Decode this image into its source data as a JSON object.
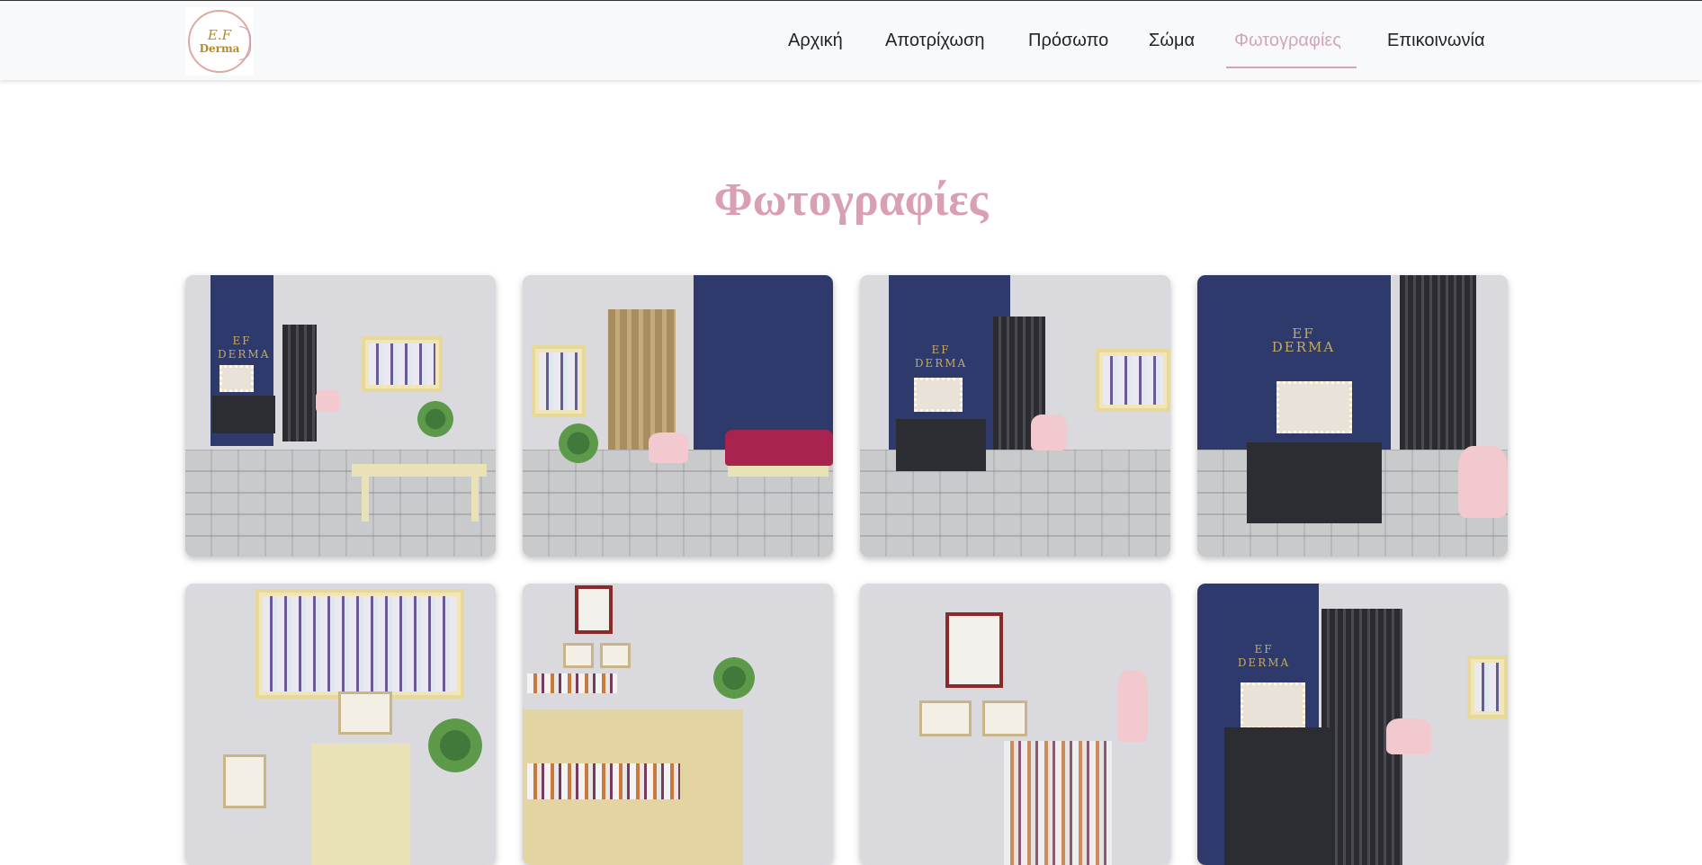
{
  "logo": {
    "line1": "E.F",
    "line2": "Derma"
  },
  "nav": {
    "items": [
      {
        "label": "Αρχική"
      },
      {
        "label": "Αποτρίχωση"
      },
      {
        "label": "Πρόσωπο"
      },
      {
        "label": "Σώμα"
      },
      {
        "label": "Φωτογραφίες"
      },
      {
        "label": "Επικοινωνία"
      }
    ],
    "active": "Φωτογραφίες"
  },
  "page": {
    "title": "Φωτογραφίες"
  },
  "gallery": {
    "photos": [
      {
        "name": "salon-overview-photo",
        "sign": "EF\nDERMA"
      },
      {
        "name": "lounge-sofa-photo",
        "sign": ""
      },
      {
        "name": "makeup-station-photo",
        "sign": "EF\nDERMA"
      },
      {
        "name": "vanity-mirror-photo",
        "sign": "EF\nDERMA"
      },
      {
        "name": "product-shelf-photo",
        "sign": ""
      },
      {
        "name": "reception-counter-photo",
        "sign": ""
      },
      {
        "name": "certificates-photo",
        "sign": ""
      },
      {
        "name": "makeup-corner-photo",
        "sign": "EF\nDERMA"
      }
    ]
  },
  "colors": {
    "accent": "#d4a5b5",
    "navy_wall": "#2e3a6b",
    "navbar_bg": "#f8f9fa"
  }
}
